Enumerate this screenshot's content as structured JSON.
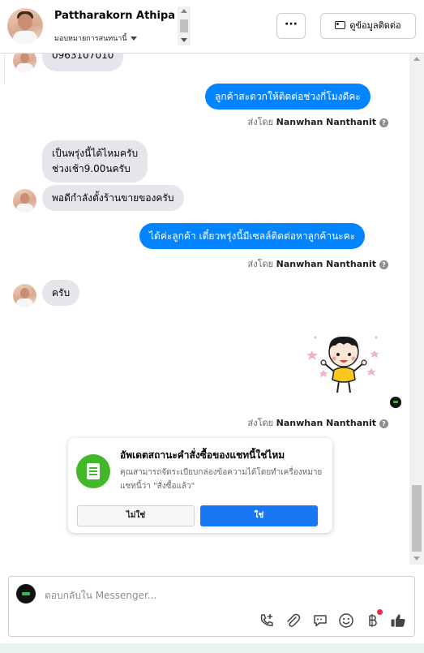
{
  "header": {
    "contact_name": "Pattharakorn Athipanya",
    "assign_label": "มอบหมายการสนทนานี้",
    "more_label": "···",
    "contact_info_label": "ดูข้อมูลติดต่อ"
  },
  "thread": {
    "partial_top_text": "0963107010",
    "messages": [
      {
        "dir": "out",
        "text": "ลูกค้าสะดวกให้ติดต่อช่วงกี่โมงดีคะ"
      },
      {
        "dir": "in",
        "lines": [
          "เป็นพรุ่งนี้ได้ไหมครับ",
          "ช่วงเช้า9.00นครับ"
        ]
      },
      {
        "dir": "in",
        "text": "พอดีกำลังตั้งร้านขายของครับ"
      },
      {
        "dir": "out",
        "text": "ได้ค่ะลูกค้า เดี๋ยวพรุ่งนี้มีเซลล์ติดต่อหาลูกค้านะคะ"
      },
      {
        "dir": "in",
        "text": "ครับ"
      }
    ],
    "sent_by_prefix": "ส่งโดย",
    "sent_by_name": "Nanwhan Nanthanit",
    "help_glyph": "?"
  },
  "status_card": {
    "title": "อัพเดตสถานะคำสั่งซื้อของแชทนี้ใช่ไหม",
    "description": "คุณสามารถจัดระเบียบกล่องข้อความได้โดยทำเครื่องหมายแชทนี้ว่า \"สั่งซื้อแล้ว\"",
    "no_label": "ไม่ใช่",
    "yes_label": "ใช่",
    "icon": "order-document-icon",
    "accent": "#42b72a"
  },
  "composer": {
    "placeholder": "ตอบกลับใน Messenger...",
    "tools": [
      "add-call-icon",
      "attachment-icon",
      "saved-replies-icon",
      "emoji-icon",
      "payment-icon",
      "thumbs-up-icon"
    ]
  },
  "colors": {
    "outgoing_bubble": "#0084ff",
    "incoming_bubble": "#e4e6eb",
    "primary_button": "#1877f2",
    "notification_dot": "#f02849"
  }
}
